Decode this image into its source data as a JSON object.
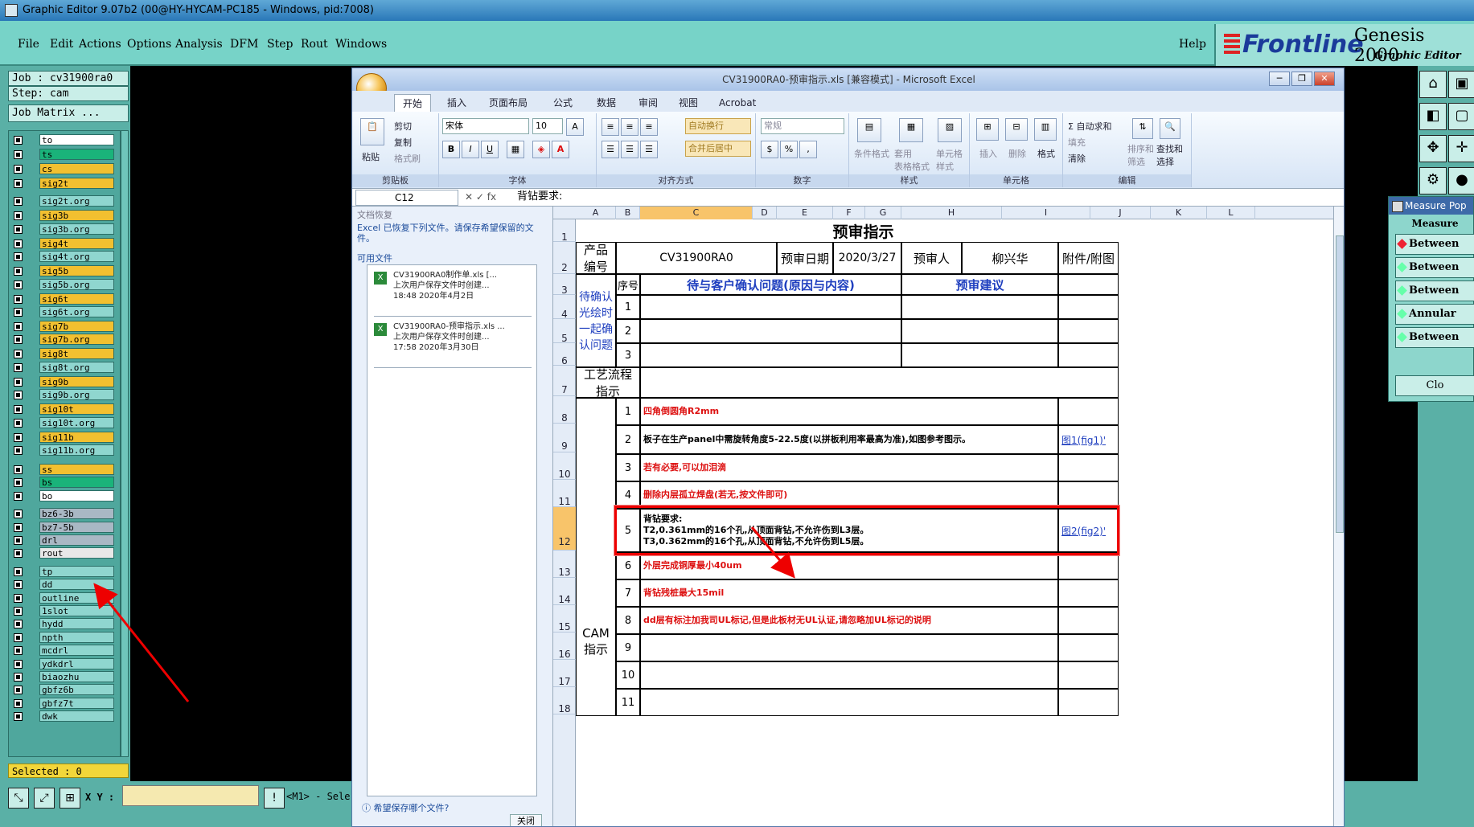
{
  "window": {
    "title": "Graphic Editor 9.07b2 (00@HY-HYCAM-PC185 - Windows, pid:7008)"
  },
  "menubar": {
    "items": [
      "File",
      "Edit",
      "Actions",
      "Options",
      "Analysis",
      "DFM",
      "Step",
      "Rout",
      "Windows"
    ],
    "help": "Help",
    "brand_logo": "Frontline",
    "brand_product": "Genesis 2000",
    "brand_sub": "Graphic Editor"
  },
  "leftpanel": {
    "job": "Job : cv31900ra0",
    "step": "Step: cam",
    "job_matrix": "Job Matrix ...",
    "selected": "Selected : 0",
    "layers": [
      {
        "name": "to",
        "color": "#ffffff"
      },
      {
        "name": "ts",
        "color": "#1ab37a"
      },
      {
        "name": "cs",
        "color": "#f2c030"
      },
      {
        "name": "sig2t",
        "color": "#f2c030"
      },
      {
        "name": "sig2t.org",
        "color": "#8fd6cf"
      },
      {
        "name": "sig3b",
        "color": "#f2c030"
      },
      {
        "name": "sig3b.org",
        "color": "#8fd6cf"
      },
      {
        "name": "sig4t",
        "color": "#f2c030"
      },
      {
        "name": "sig4t.org",
        "color": "#8fd6cf"
      },
      {
        "name": "sig5b",
        "color": "#f2c030"
      },
      {
        "name": "sig5b.org",
        "color": "#8fd6cf"
      },
      {
        "name": "sig6t",
        "color": "#f2c030"
      },
      {
        "name": "sig6t.org",
        "color": "#8fd6cf"
      },
      {
        "name": "sig7b",
        "color": "#f2c030"
      },
      {
        "name": "sig7b.org",
        "color": "#f2c030"
      },
      {
        "name": "sig8t",
        "color": "#f2c030"
      },
      {
        "name": "sig8t.org",
        "color": "#8fd6cf"
      },
      {
        "name": "sig9b",
        "color": "#f2c030"
      },
      {
        "name": "sig9b.org",
        "color": "#8fd6cf"
      },
      {
        "name": "sig10t",
        "color": "#f2c030"
      },
      {
        "name": "sig10t.org",
        "color": "#8fd6cf"
      },
      {
        "name": "sig11b",
        "color": "#f2c030"
      },
      {
        "name": "sig11b.org",
        "color": "#8fd6cf"
      },
      {
        "name": "ss",
        "color": "#f2c030"
      },
      {
        "name": "bs",
        "color": "#1ab37a"
      },
      {
        "name": "bo",
        "color": "#ffffff"
      },
      {
        "name": "bz6-3b",
        "color": "#a9b8c4"
      },
      {
        "name": "bz7-5b",
        "color": "#a9b8c4"
      },
      {
        "name": "drl",
        "color": "#a9b8c4"
      },
      {
        "name": "rout",
        "color": "#e8e8e8"
      },
      {
        "name": "tp",
        "color": "#8fd6cf"
      },
      {
        "name": "dd",
        "color": "#8fd6cf"
      },
      {
        "name": "outline",
        "color": "#8fd6cf"
      },
      {
        "name": "1slot",
        "color": "#8fd6cf"
      },
      {
        "name": "hydd",
        "color": "#8fd6cf"
      },
      {
        "name": "npth",
        "color": "#8fd6cf"
      },
      {
        "name": "mcdrl",
        "color": "#8fd6cf"
      },
      {
        "name": "ydkdrl",
        "color": "#8fd6cf"
      },
      {
        "name": "biaozhu",
        "color": "#8fd6cf"
      },
      {
        "name": "gbfz6b",
        "color": "#8fd6cf"
      },
      {
        "name": "gbfz7t",
        "color": "#8fd6cf"
      },
      {
        "name": "dwk",
        "color": "#8fd6cf"
      }
    ]
  },
  "bottombar": {
    "xy_label": "X Y :",
    "message": "<M1> - Sele"
  },
  "measure": {
    "title": "Measure Pop",
    "header": "Measure",
    "rows": [
      "Between",
      "Between",
      "Between",
      "Annular",
      "Between"
    ],
    "close": "Clo"
  },
  "excel": {
    "title": "CV31900RA0-预审指示.xls  [兼容模式] - Microsoft Excel",
    "tabs": [
      "开始",
      "插入",
      "页面布局",
      "公式",
      "数据",
      "审阅",
      "视图",
      "Acrobat"
    ],
    "ribbon": {
      "clipboard": {
        "label": "剪贴板",
        "paste": "粘贴",
        "cut": "剪切",
        "copy": "复制",
        "painter": "格式刷"
      },
      "font": {
        "label": "字体",
        "name": "宋体",
        "size": "10"
      },
      "align": {
        "label": "对齐方式",
        "wrap": "自动换行",
        "merge": "合并后居中"
      },
      "number": {
        "label": "数字",
        "format": "常规"
      },
      "styles": {
        "label": "样式",
        "cond": "条件格式",
        "table": "套用\n表格格式",
        "cell": "单元格\n样式"
      },
      "cells": {
        "label": "单元格",
        "insert": "插入",
        "delete": "删除",
        "format": "格式"
      },
      "edit": {
        "label": "编辑",
        "sum": "自动求和",
        "fill": "填充",
        "clear": "清除",
        "sort": "排序和\n筛选",
        "find": "查找和\n选择"
      }
    },
    "namebox": "C12",
    "formula": "背钻要求:",
    "recovery": {
      "heading": "文档恢复",
      "text": "Excel 已恢复下列文件。请保存希望保留的文件。",
      "available": "可用文件",
      "files": [
        {
          "name": "CV31900RA0制作单.xls  [...",
          "desc": "上次用户保存文件时创建...",
          "time": "18:48 2020年4月2日"
        },
        {
          "name": "CV31900RA0-预审指示.xls ...",
          "desc": "上次用户保存文件时创建...",
          "time": "17:58 2020年3月30日"
        }
      ],
      "question": "希望保存哪个文件?",
      "close": "关闭"
    },
    "columns": [
      "A",
      "B",
      "C",
      "D",
      "E",
      "F",
      "G",
      "H",
      "I",
      "J",
      "K",
      "L"
    ],
    "rows": [
      "1",
      "2",
      "3",
      "4",
      "5",
      "6",
      "7",
      "8",
      "9",
      "10",
      "11",
      "12",
      "13",
      "14",
      "15",
      "16",
      "17",
      "18"
    ],
    "sheet": {
      "title": "预审指示",
      "product_label": "产品\n编号",
      "product_value": "CV31900RA0",
      "date_label": "预审日期",
      "date_value": "2020/3/27",
      "reviewer_label": "预审人",
      "reviewer_value": "柳兴华",
      "attach_label": "附件/附图",
      "seq_label": "序号",
      "question_header": "待与客户确认问题(原因与内容)",
      "suggest_header": "预审建议",
      "pending_label": "待确认\n光绘时\n一起确\n认问题",
      "process_label": "工艺流程\n指示",
      "cam_label": "CAM\n指示",
      "q_nums": [
        "1",
        "2",
        "3"
      ],
      "items": [
        {
          "n": "1",
          "text": "四角倒圆角R2mm",
          "red": true,
          "link": ""
        },
        {
          "n": "2",
          "text": "板子在生产panel中需旋转角度5-22.5度(以拼板利用率最高为准),如图参考图示。",
          "red": false,
          "link": "图1(fig1)'"
        },
        {
          "n": "3",
          "text": "若有必要,可以加泪滴",
          "red": true,
          "link": ""
        },
        {
          "n": "4",
          "text": "删除内层孤立焊盘(若无,按文件即可)",
          "red": true,
          "link": ""
        },
        {
          "n": "5",
          "text": "背钻要求:\nT2,0.361mm的16个孔,从顶面背钻,不允许伤到L3层。\nT3,0.362mm的16个孔,从顶面背钻,不允许伤到L5层。",
          "red": false,
          "link": "图2(fig2)'"
        },
        {
          "n": "6",
          "text": "外层完成铜厚最小40um",
          "red": true,
          "link": ""
        },
        {
          "n": "7",
          "text": "背钻残桩最大15mil",
          "red": true,
          "link": ""
        },
        {
          "n": "8",
          "text": "dd层有标注加我司UL标记,但是此板材无UL认证,请忽略加UL标记的说明",
          "red": true,
          "link": ""
        },
        {
          "n": "9",
          "text": "",
          "red": false,
          "link": ""
        },
        {
          "n": "10",
          "text": "",
          "red": false,
          "link": ""
        },
        {
          "n": "11",
          "text": "",
          "red": false,
          "link": ""
        }
      ]
    }
  }
}
